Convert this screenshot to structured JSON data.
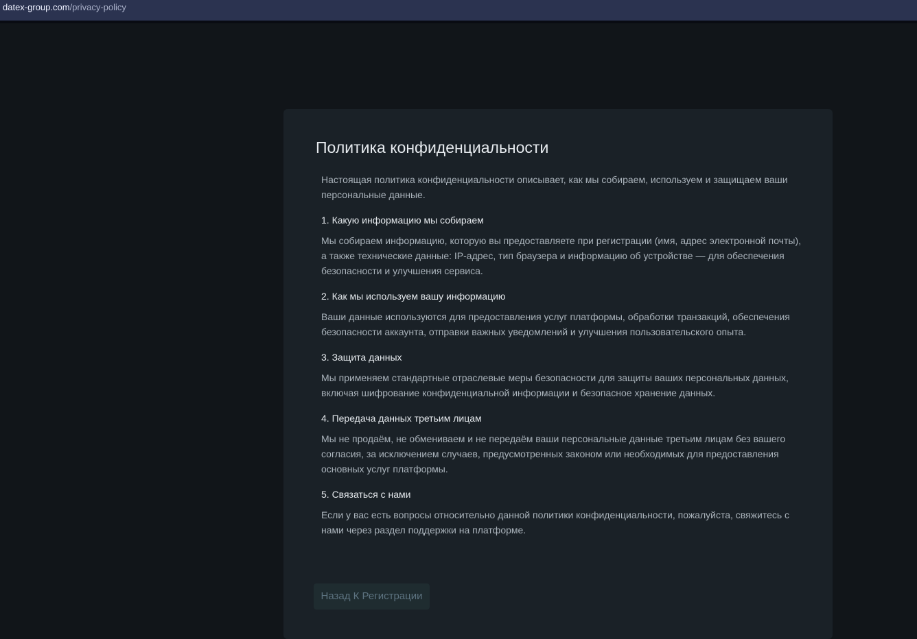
{
  "browser": {
    "url_domain": "datex-group.com",
    "url_path": "/privacy-policy"
  },
  "policy": {
    "title": "Политика конфиденциальности",
    "intro": "Настоящая политика конфиденциальности описывает, как мы собираем, используем и защищаем ваши персональные данные.",
    "sections": [
      {
        "heading": "1. Какую информацию мы собираем",
        "text": "Мы собираем информацию, которую вы предоставляете при регистрации (имя, адрес электронной почты), а также технические данные: IP-адрес, тип браузера и информацию об устройстве — для обеспечения безопасности и улучшения сервиса."
      },
      {
        "heading": "2. Как мы используем вашу информацию",
        "text": "Ваши данные используются для предоставления услуг платформы, обработки транзакций, обеспечения безопасности аккаунта, отправки важных уведомлений и улучшения пользовательского опыта."
      },
      {
        "heading": "3. Защита данных",
        "text": "Мы применяем стандартные отраслевые меры безопасности для защиты ваших персональных данных, включая шифрование конфиденциальной информации и безопасное хранение данных."
      },
      {
        "heading": "4. Передача данных третьим лицам",
        "text": "Мы не продаём, не обмениваем и не передаём ваши персональные данные третьим лицам без вашего согласия, за исключением случаев, предусмотренных законом или необходимых для предоставления основных услуг платформы."
      },
      {
        "heading": "5. Связаться с нами",
        "text": "Если у вас есть вопросы относительно данной политики конфиденциальности, пожалуйста, свяжитесь с нами через раздел поддержки на платформе."
      }
    ],
    "back_button_label": "Назад К Регистрации"
  }
}
